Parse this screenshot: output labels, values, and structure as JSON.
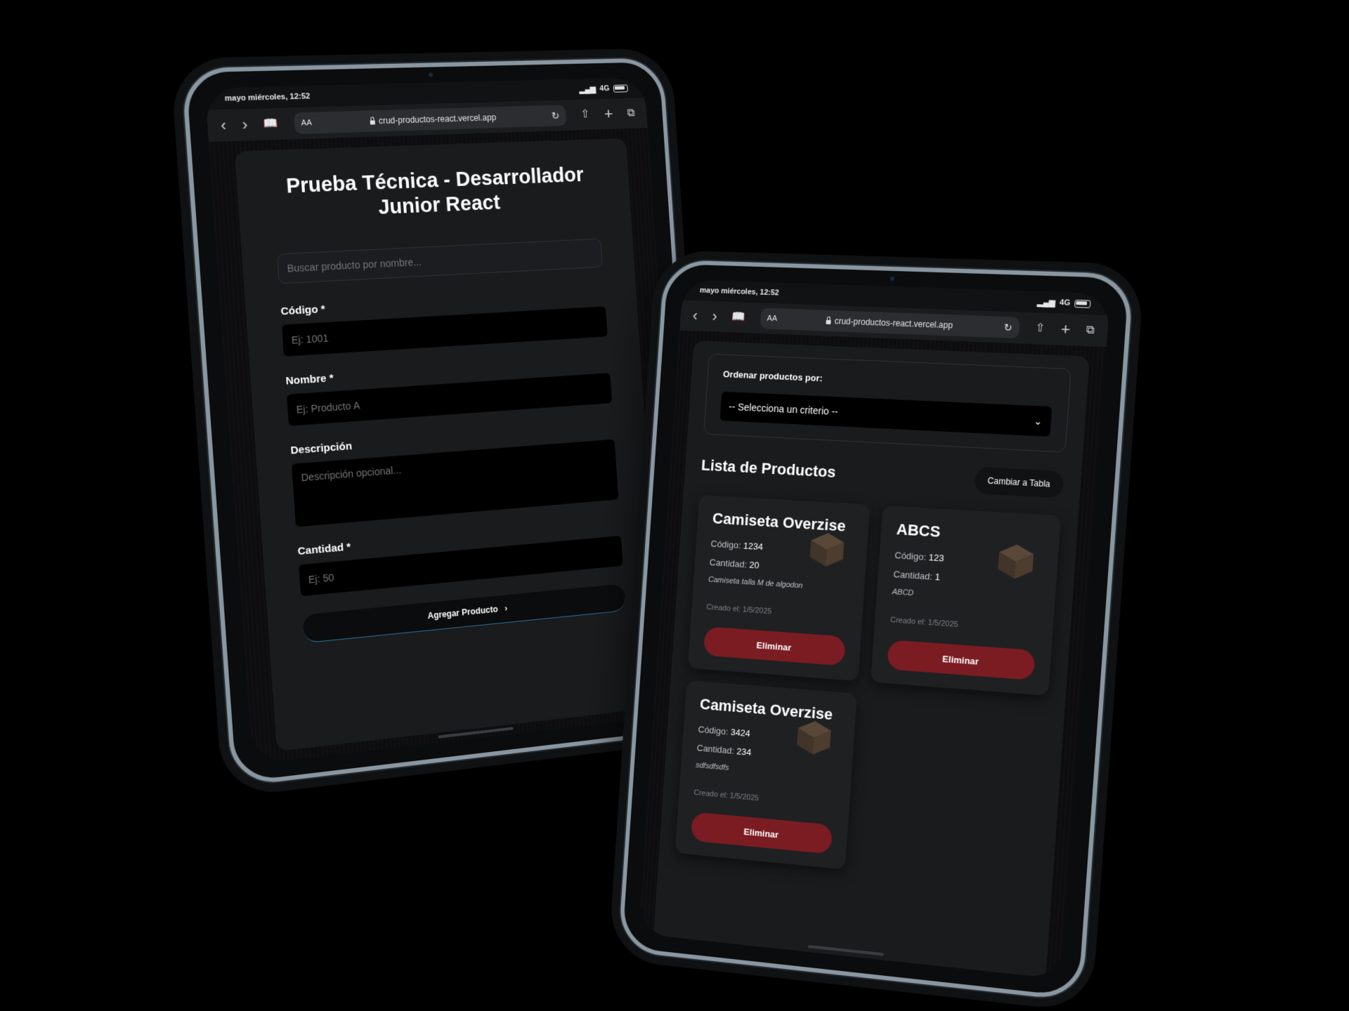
{
  "colors": {
    "background": "#000000",
    "card": "#1a1b1d",
    "danger": "#7b1c22",
    "accent_line": "#2a6f9a"
  },
  "browser": {
    "status_time": "mayo miércoles, 12:52",
    "signal": "4G",
    "aa": "AA",
    "url": "crud-productos-react.vercel.app",
    "icons": [
      "back-icon",
      "forward-icon",
      "bookmarks-icon",
      "reload-icon",
      "share-icon",
      "new-tab-icon",
      "tabs-icon"
    ]
  },
  "form": {
    "title": "Prueba Técnica - Desarrollador Junior React",
    "search_placeholder": "Buscar producto por nombre...",
    "codigo_label": "Código *",
    "codigo_placeholder": "Ej: 1001",
    "nombre_label": "Nombre *",
    "nombre_placeholder": "Ej: Producto A",
    "descripcion_label": "Descripción",
    "descripcion_placeholder": "Descripción opcional...",
    "cantidad_label": "Cantidad *",
    "cantidad_placeholder": "Ej: 50",
    "submit_label": "Agregar Producto",
    "submit_icon": "›"
  },
  "list": {
    "sort_label": "Ordenar productos por:",
    "sort_selected": "-- Selecciona un criterio --",
    "title": "Lista de Productos",
    "toggle_label": "Cambiar a Tabla",
    "codigo_prefix": "Código:",
    "cantidad_prefix": "Cantidad:",
    "created_prefix": "Creado el:",
    "delete_label": "Eliminar",
    "products": [
      {
        "name": "Camiseta Overzise",
        "codigo": "1234",
        "cantidad": "20",
        "descripcion": "Camiseta talla M de algodon",
        "created": "1/5/2025"
      },
      {
        "name": "ABCS",
        "codigo": "123",
        "cantidad": "1",
        "descripcion": "ABCD",
        "created": "1/5/2025"
      },
      {
        "name": "Camiseta Overzise",
        "codigo": "3424",
        "cantidad": "234",
        "descripcion": "sdfsdfsdfs",
        "created": "1/5/2025"
      }
    ]
  }
}
